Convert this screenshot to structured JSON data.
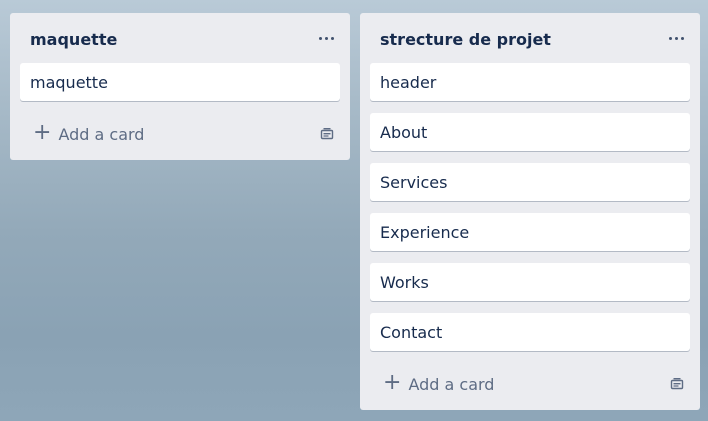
{
  "lists": [
    {
      "title": "maquette",
      "cards": [
        "maquette"
      ],
      "add_label": "Add a card"
    },
    {
      "title": "strecture de projet",
      "cards": [
        "header",
        "About",
        "Services",
        "Experience",
        "Works",
        "Contact"
      ],
      "add_label": "Add a card"
    }
  ],
  "icons": {
    "menu": "more-horizontal-icon",
    "add": "plus-icon",
    "template": "card-template-icon"
  },
  "colors": {
    "list_bg": "#ebecf0",
    "card_bg": "#ffffff",
    "title_text": "#172b4d",
    "muted_text": "#5e6c84"
  }
}
